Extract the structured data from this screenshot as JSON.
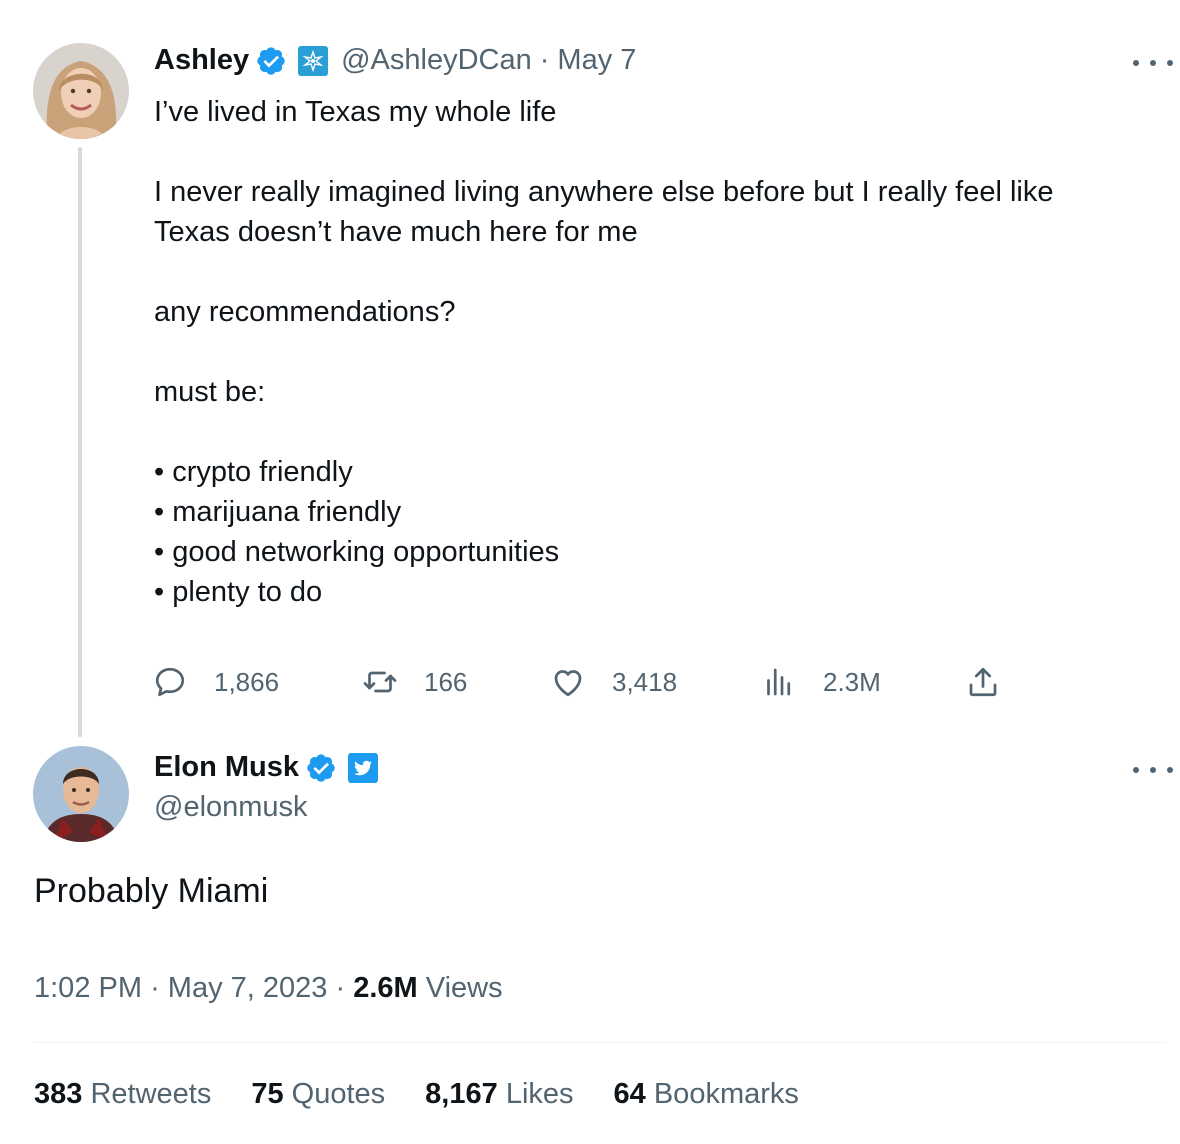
{
  "original_tweet": {
    "display_name": "Ashley",
    "handle": "@AshleyDCan",
    "separator": "·",
    "date": "May 7",
    "lines": [
      "I’ve lived in Texas my whole life",
      "",
      "I never really imagined living anywhere else before but I really feel like",
      "Texas doesn’t have much here for me",
      "",
      "any recommendations?",
      "",
      "must be:",
      "",
      "• crypto friendly",
      "• marijuana friendly",
      "• good networking opportunities",
      "• plenty to do"
    ],
    "actions": {
      "replies": "1,866",
      "retweets": "166",
      "likes": "3,418",
      "views": "2.3M"
    }
  },
  "reply_tweet": {
    "display_name": "Elon Musk",
    "handle": "@elonmusk",
    "text": "Probably Miami",
    "time": "1:02 PM",
    "date": "May 7, 2023",
    "separator": "·",
    "views_count": "2.6M",
    "views_label": "Views"
  },
  "stats": [
    {
      "count": "383",
      "label": "Retweets"
    },
    {
      "count": "75",
      "label": "Quotes"
    },
    {
      "count": "8,167",
      "label": "Likes"
    },
    {
      "count": "64",
      "label": "Bookmarks"
    }
  ],
  "colors": {
    "verified_blue": "#1d9bf0",
    "secondary_text": "#536471",
    "primary_text": "#0f1419",
    "thread_line": "#cfd9de",
    "affiliate_badge": "#2a9fd6"
  },
  "icons": [
    "verified-badge-icon",
    "affiliate-badge-icon",
    "twitter-bird-icon",
    "more-icon",
    "reply-icon",
    "retweet-icon",
    "like-icon",
    "views-icon",
    "share-icon"
  ]
}
